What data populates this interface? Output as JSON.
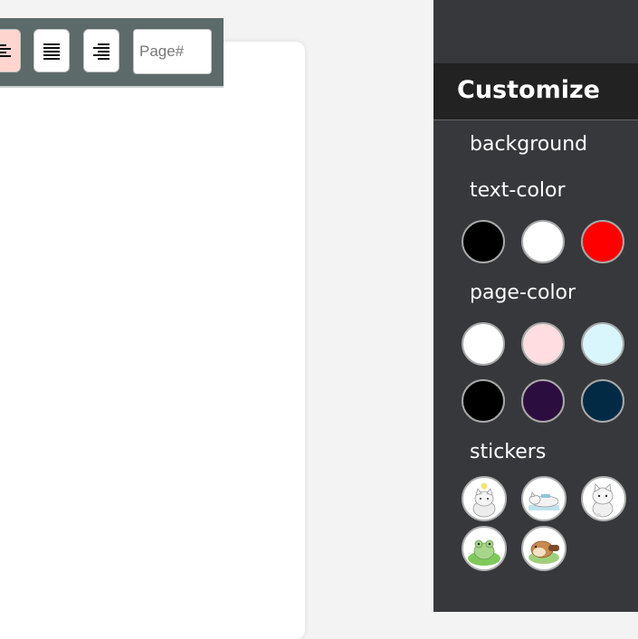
{
  "toolbar": {
    "buttons": [
      {
        "name": "align-left",
        "icon": "align-left-icon",
        "active": true
      },
      {
        "name": "align-justify",
        "icon": "align-justify-icon",
        "active": false
      },
      {
        "name": "align-right",
        "icon": "align-right-icon",
        "active": false
      }
    ],
    "page_number_placeholder": "Page#",
    "active_color": "#ffd6cf",
    "background_color": "#5d6a6a"
  },
  "panel": {
    "title": "Customize",
    "sections": {
      "background": "background",
      "text_color": "text-color",
      "page_color": "page-color",
      "stickers": "stickers"
    },
    "text_colors": [
      "#000000",
      "#ffffff",
      "#ff0000"
    ],
    "page_colors": [
      "#ffffff",
      "#ffdde1",
      "#d8f6fb",
      "#000000",
      "#2c0d3f",
      "#022a44"
    ],
    "stickers": [
      "cat-idea-sticker",
      "cat-lying-sticker",
      "cat-sitting-sticker",
      "frog-sticker",
      "hamster-sticker"
    ]
  }
}
